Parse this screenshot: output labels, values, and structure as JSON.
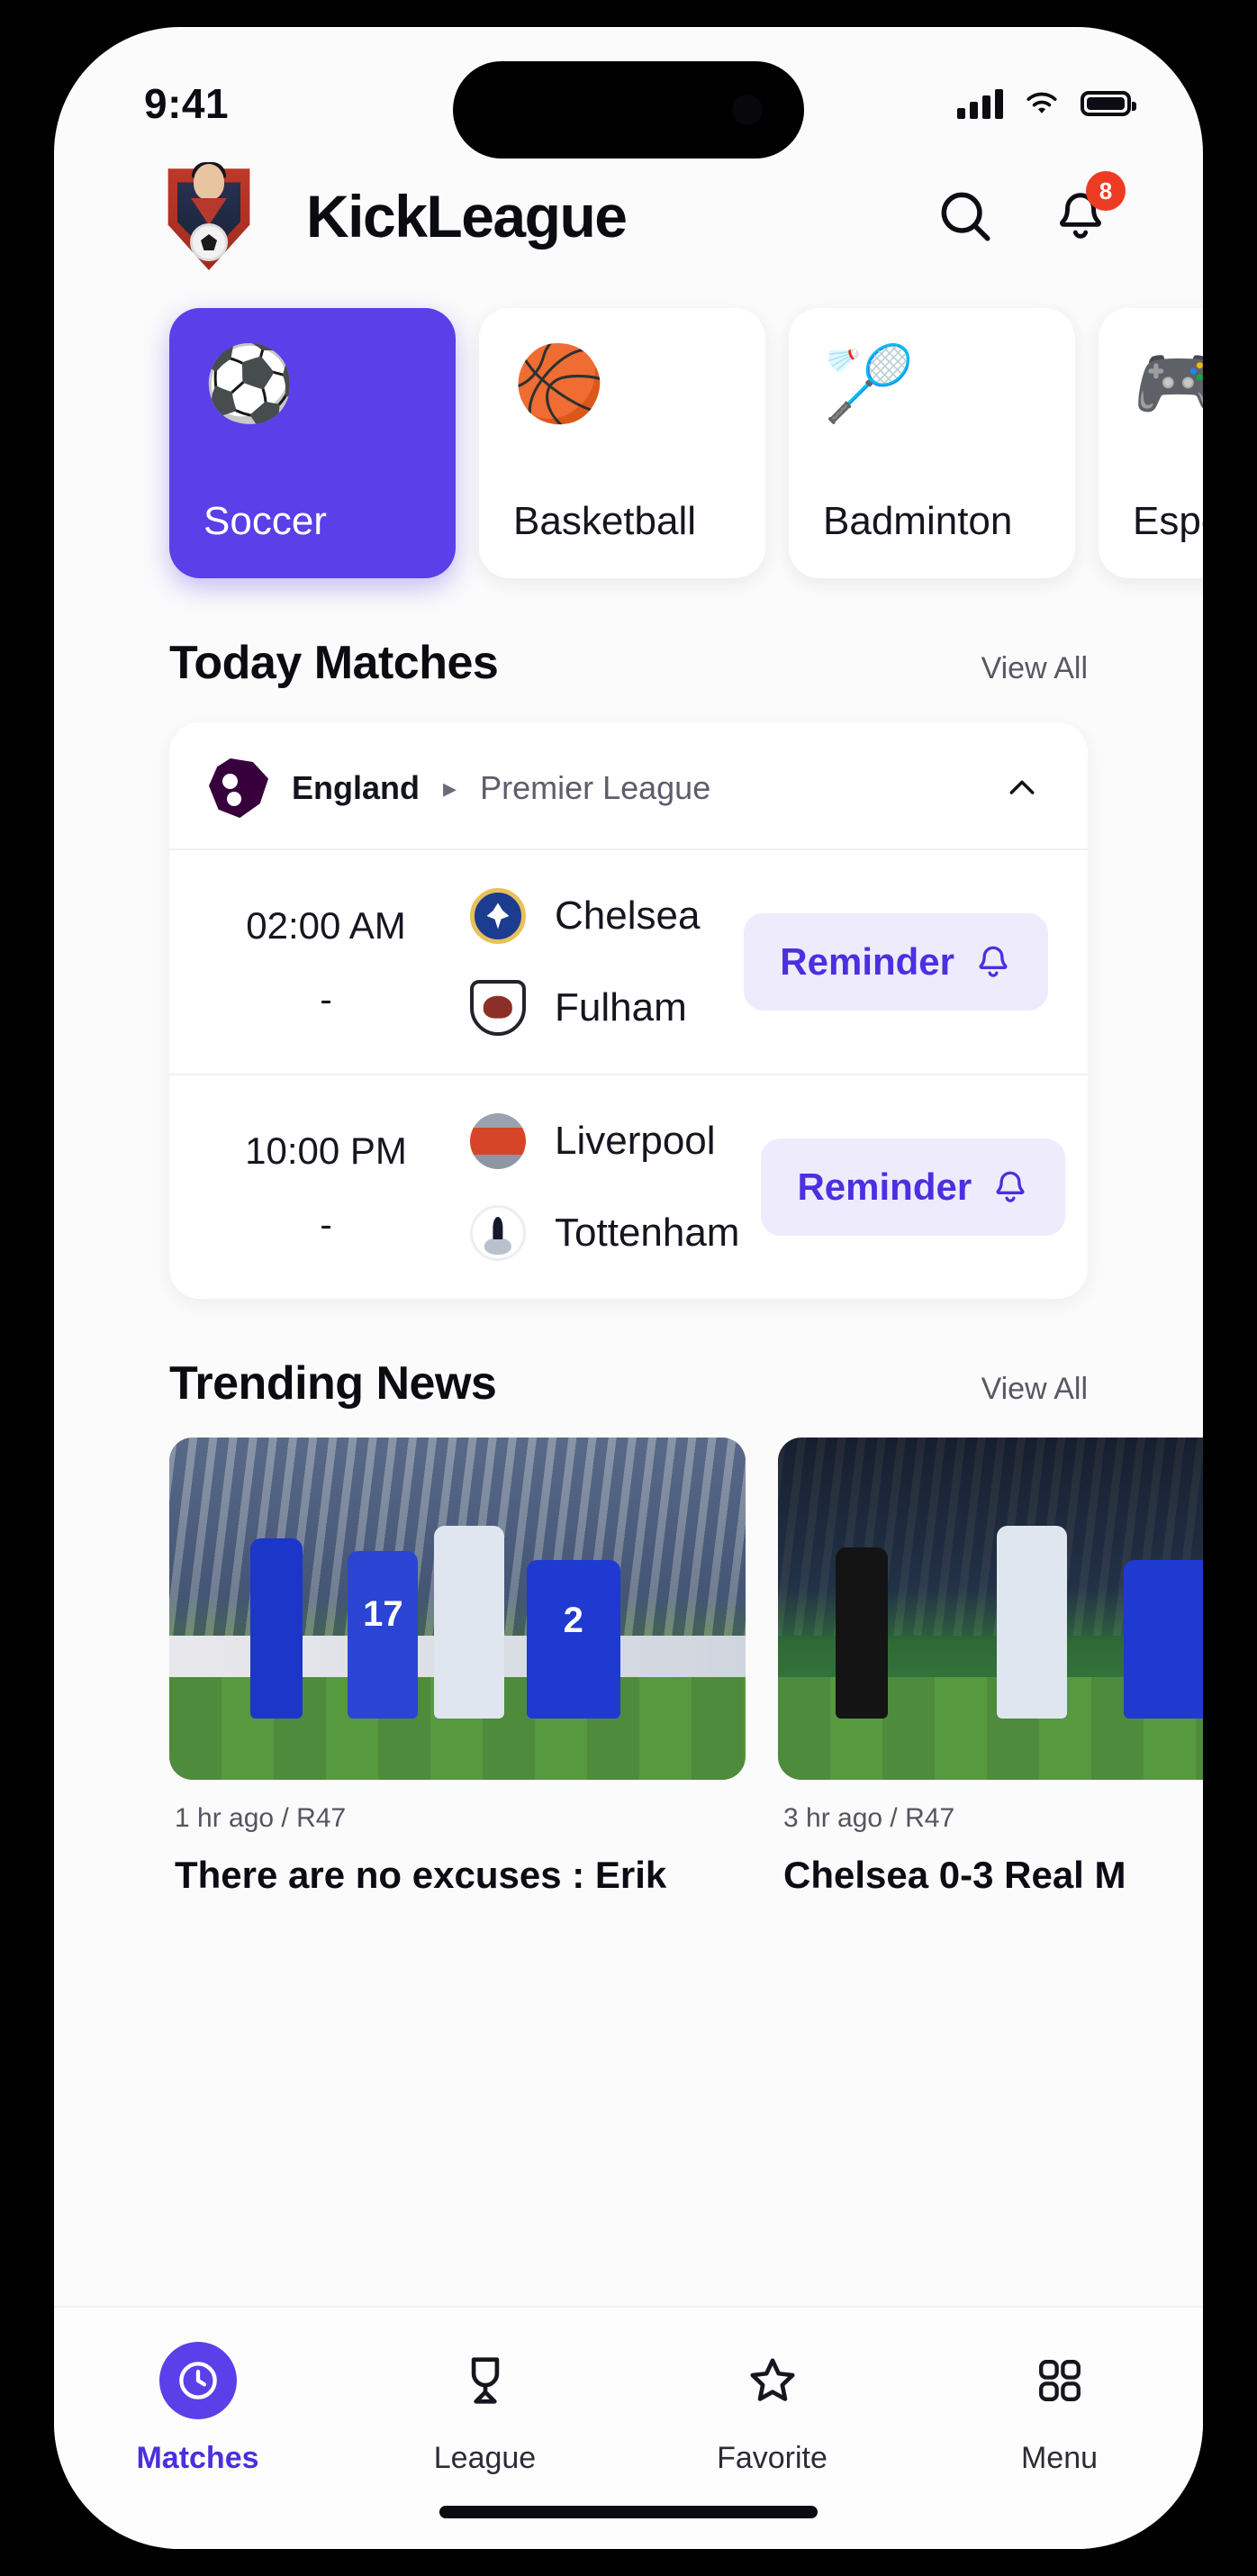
{
  "status_bar": {
    "time": "9:41",
    "signal_icon": "cellular-bars-icon",
    "wifi_icon": "wifi-icon",
    "battery_icon": "battery-icon"
  },
  "header": {
    "logo_icon": "kickleague-shield-logo",
    "title": "KickLeague",
    "search_icon": "search-icon",
    "bell_icon": "bell-icon",
    "notification_count": "8"
  },
  "sport_tabs": [
    {
      "label": "Soccer",
      "emoji": "⚽",
      "icon": "soccer-ball-icon",
      "active": true
    },
    {
      "label": "Basketball",
      "emoji": "🏀",
      "icon": "basketball-icon",
      "active": false
    },
    {
      "label": "Badminton",
      "emoji": "🏸",
      "icon": "badminton-icon",
      "active": false
    },
    {
      "label": "Esports",
      "emoji": "🎮",
      "icon": "gamepad-icon",
      "active": false
    }
  ],
  "today_matches": {
    "title": "Today Matches",
    "view_all": "View All",
    "league": {
      "country": "England",
      "separator": "▸",
      "name": "Premier League",
      "logo_icon": "premier-league-lion-icon",
      "collapse_icon": "chevron-up-icon"
    },
    "matches": [
      {
        "time": "02:00 AM",
        "dash": "-",
        "home_team": "Chelsea",
        "home_crest": "chelsea-crest-icon",
        "away_team": "Fulham",
        "away_crest": "fulham-crest-icon",
        "reminder_label": "Reminder",
        "reminder_icon": "bell-icon"
      },
      {
        "time": "10:00 PM",
        "dash": "-",
        "home_team": "Liverpool",
        "home_crest": "liverpool-crest-icon",
        "away_team": "Tottenham",
        "away_crest": "tottenham-crest-icon",
        "reminder_label": "Reminder",
        "reminder_icon": "bell-icon"
      }
    ]
  },
  "trending_news": {
    "title": "Trending News",
    "view_all": "View All",
    "articles": [
      {
        "meta": "1 hr ago / R47",
        "title": "There are no excuses : Erik"
      },
      {
        "meta": "3 hr ago / R47",
        "title": "Chelsea 0-3 Real M"
      }
    ]
  },
  "bottom_nav": [
    {
      "label": "Matches",
      "icon": "clock-icon",
      "active": true
    },
    {
      "label": "League",
      "icon": "trophy-icon",
      "active": false
    },
    {
      "label": "Favorite",
      "icon": "star-icon",
      "active": false
    },
    {
      "label": "Menu",
      "icon": "grid-icon",
      "active": false
    }
  ],
  "colors": {
    "accent": "#5b3fe8",
    "accent_text": "#4b2fe0",
    "badge": "#ee3b24",
    "background": "#fbfbfb"
  }
}
